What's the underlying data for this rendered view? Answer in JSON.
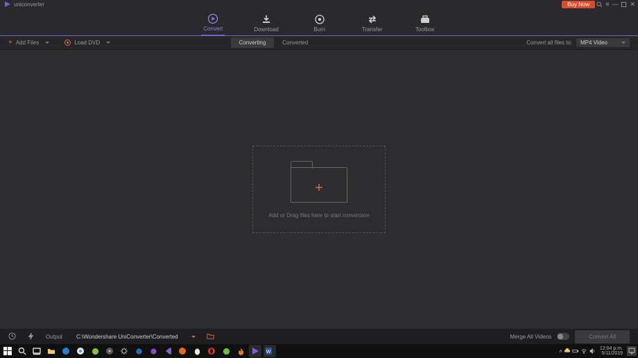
{
  "title": "uniconverter",
  "buy_label": "Buy Now",
  "nav": {
    "convert": "Convert",
    "download": "Download",
    "burn": "Burn",
    "transfer": "Transfer",
    "toolbox": "Toolbox"
  },
  "toolbar": {
    "add_files": "Add Files",
    "load_dvd": "Load DVD",
    "seg_converting": "Converting",
    "seg_converted": "Converted",
    "convert_to_label": "Convert all files to:",
    "format": "MP4 Video"
  },
  "drop": {
    "hint": "Add or Drag files here to start conversion"
  },
  "footer": {
    "output_label": "Output",
    "output_path": "C:\\Wondershare UniConverter\\Converted",
    "merge": "Merge All Videos",
    "convert_all": "Convert All"
  },
  "tray": {
    "time": "12:04 p.m.",
    "date": "5/11/2019"
  }
}
